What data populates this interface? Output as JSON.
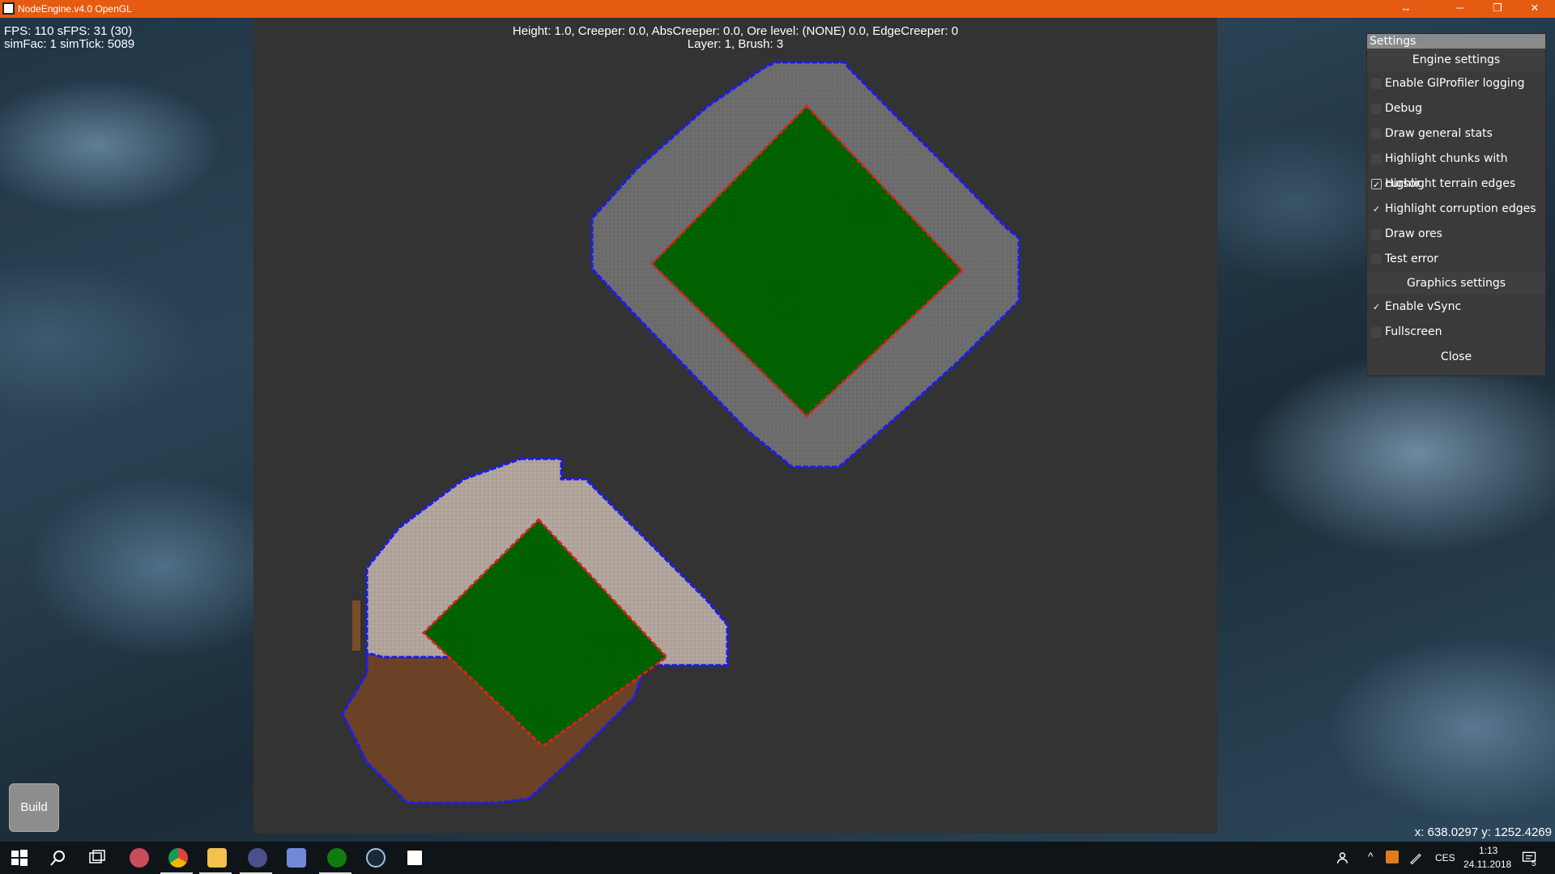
{
  "window": {
    "title": "NodeEngine.v4.0 OpenGL",
    "controls": {
      "resize": "↔",
      "minimize": "─",
      "restore": "❐",
      "close": "✕"
    }
  },
  "hud": {
    "stats_line1": "FPS: 110 sFPS: 31 (30)",
    "stats_line2": "simFac: 1 simTick: 5089",
    "info_line1": "Height: 1.0, Creeper: 0.0, AbsCreeper: 0.0, Ore level: (NONE) 0.0, EdgeCreeper: 0",
    "info_line2": "Layer: 1, Brush: 3",
    "coords": "x: 638.0297 y: 1252.4269"
  },
  "build_button": {
    "label": "Build"
  },
  "settings": {
    "title": "Settings",
    "engine_header": "Engine settings",
    "engine_items": [
      {
        "label": "Enable GlProfiler logging",
        "state": "off"
      },
      {
        "label": "Debug",
        "state": "off"
      },
      {
        "label": "Draw general stats",
        "state": "off"
      },
      {
        "label": "Highlight chunks with cursor",
        "state": "off"
      },
      {
        "label": "Highlight terrain edges",
        "state": "checked"
      },
      {
        "label": "Highlight corruption edges",
        "state": "tick"
      },
      {
        "label": "Draw ores",
        "state": "off"
      },
      {
        "label": "Test error",
        "state": "off"
      }
    ],
    "graphics_header": "Graphics settings",
    "graphics_items": [
      {
        "label": "Enable vSync",
        "state": "tick"
      },
      {
        "label": "Fullscreen",
        "state": "off"
      }
    ],
    "close_label": "Close"
  },
  "taskbar": {
    "icons": [
      "windows-start-icon",
      "search-icon",
      "task-view-icon",
      "app-icon",
      "chrome-icon",
      "file-explorer-icon",
      "app-icon",
      "discord-icon",
      "xbox-icon",
      "steam-icon",
      "nodeengine-icon"
    ],
    "language": "CES",
    "time": "1:13",
    "date": "24.11.2018",
    "notifications_count": "5"
  },
  "colors": {
    "titlebar": "#e55b12",
    "terrain_edge": "#1a1aff",
    "corruption_edge": "#e02020",
    "creeper_green": "#006400",
    "terrain_gray": "#6f6f6f",
    "dirt": "#6b4226"
  }
}
